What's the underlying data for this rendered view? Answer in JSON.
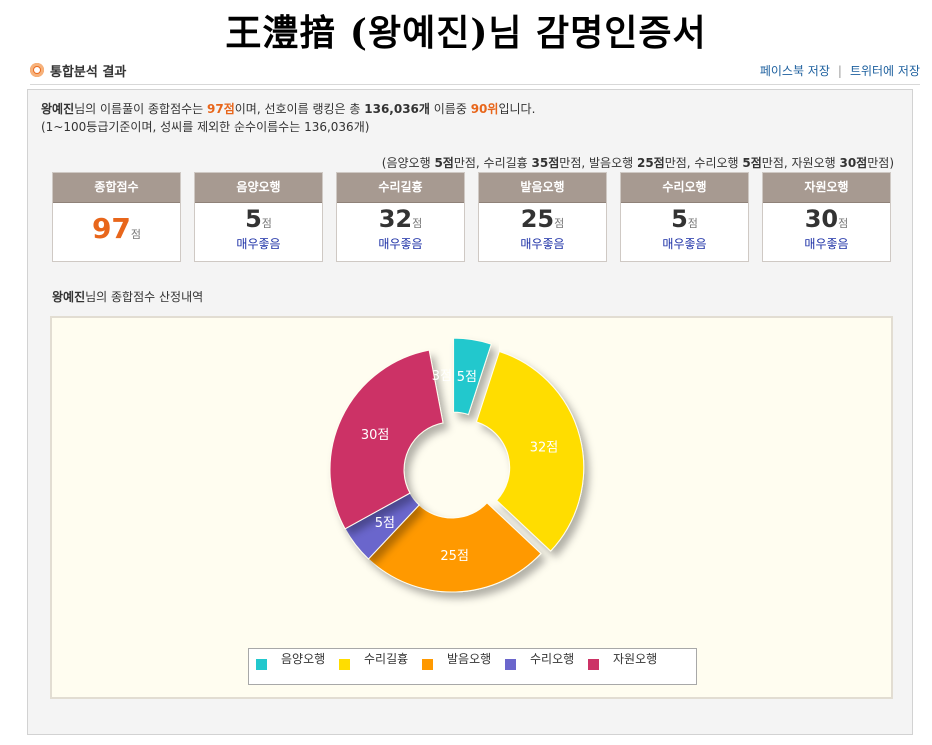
{
  "title": "王澧揞 (왕예진)님 감명인증서",
  "section": {
    "title": "통합분석 결과",
    "share_facebook": "페이스북 저장",
    "share_separator": "|",
    "share_twitter": "트위터에 저장"
  },
  "summary": {
    "name": "왕예진",
    "text1": "님의 이름풀이 종합점수는 ",
    "score": "97점",
    "text2": "이며, 선호이름 랭킹은 총 ",
    "total_names": "136,036개",
    "text3": " 이름중 ",
    "rank": "90위",
    "text4": "입니다.",
    "line2": "(1~100등급기준이며, 성씨를 제외한 순수이름수는 136,036개)"
  },
  "max_scores": {
    "open": "(음양오행 ",
    "v1": "5점",
    "t1": "만점, 수리길흉 ",
    "v2": "35점",
    "t2": "만점, 발음오행 ",
    "v3": "25점",
    "t3": "만점, 수리오행 ",
    "v4": "5점",
    "t4": "만점, 자원오행 ",
    "v5": "30점",
    "t5": "만점)"
  },
  "cards": [
    {
      "label": "종합점수",
      "score": "97",
      "unit": "점",
      "grade": ""
    },
    {
      "label": "음양오행",
      "score": "5",
      "unit": "점",
      "grade": "매우좋음"
    },
    {
      "label": "수리길흉",
      "score": "32",
      "unit": "점",
      "grade": "매우좋음"
    },
    {
      "label": "발음오행",
      "score": "25",
      "unit": "점",
      "grade": "매우좋음"
    },
    {
      "label": "수리오행",
      "score": "5",
      "unit": "점",
      "grade": "매우좋음"
    },
    {
      "label": "자원오행",
      "score": "30",
      "unit": "점",
      "grade": "매우좋음"
    }
  ],
  "chart_section": {
    "name": "왕예진",
    "label_suffix": "님의 종합점수 산정내역"
  },
  "chart_data": {
    "type": "pie",
    "donut": true,
    "categories": [
      "음양오행",
      "수리길흉",
      "발음오행",
      "수리오행",
      "자원오행"
    ],
    "values": [
      5,
      32,
      25,
      5,
      30
    ],
    "slice_labels": [
      "5점",
      "32점",
      "25점",
      "5점",
      "30점"
    ],
    "other_label": "3점",
    "colors": [
      "#22c8cd",
      "#ffdd00",
      "#ff9900",
      "#6b66cc",
      "#cc3366"
    ],
    "exploded": [
      "음양오행",
      "수리길흉"
    ],
    "legend_position": "bottom"
  }
}
